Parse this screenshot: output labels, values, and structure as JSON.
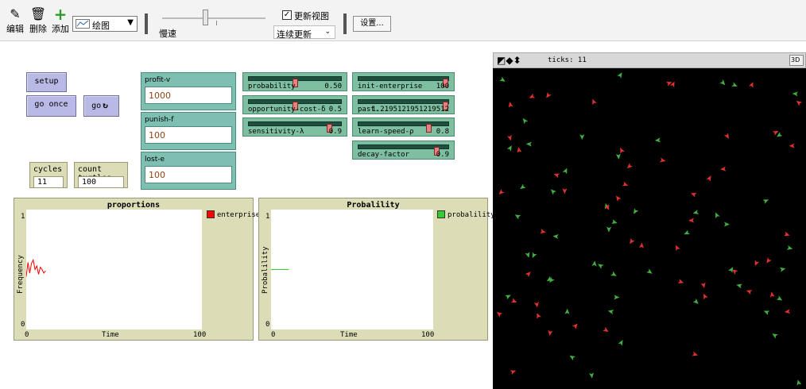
{
  "toolbar": {
    "edit_label": "编辑",
    "delete_label": "删除",
    "add_label": "添加",
    "shape_select_value": "绘图",
    "speed_label": "慢速",
    "speed_level": 0.45,
    "update_view_checked": true,
    "update_view_label": "更新视图",
    "update_mode_value": "连续更新",
    "settings_label": "设置..."
  },
  "buttons": {
    "setup": "setup",
    "go_once": "go once",
    "go": "go",
    "forever_icon": "forever-icon"
  },
  "monitors": {
    "cycles": {
      "label": "cycles",
      "value": "11"
    },
    "count_turtles": {
      "label": "count turtles",
      "value": "100"
    }
  },
  "inputs": {
    "profit_v": {
      "label": "profit-v",
      "value": "1000"
    },
    "punish_f": {
      "label": "punish-f",
      "value": "100"
    },
    "lost_e": {
      "label": "lost-e",
      "value": "100"
    }
  },
  "sliders": {
    "probability": {
      "label": "probability",
      "value": "0.50",
      "fraction": 0.5
    },
    "opportunity_cost": {
      "label": "opportunity-cost-δ",
      "value": "0.5",
      "fraction": 0.5
    },
    "sensitivity": {
      "label": "sensitivity-λ",
      "value": "0.9",
      "fraction": 0.9
    },
    "init_enterprise": {
      "label": "init-enterprise",
      "value": "100",
      "fraction": 1.0
    },
    "past": {
      "label": "past...",
      "value": "1.2195121951219512",
      "fraction": 1.0
    },
    "learn_speed": {
      "label": "learn-speed-ρ",
      "value": "0.8",
      "fraction": 0.8
    },
    "decay_factor": {
      "label": "decay-factor",
      "value": "0.9",
      "fraction": 0.9
    }
  },
  "plots": {
    "proportions": {
      "title": "proportions",
      "xlabel": "Time",
      "ylabel": "Frequency",
      "x_min": "0",
      "x_max": "100",
      "y_min": "0",
      "y_max": "1",
      "legend": "enterprise",
      "legend_color": "#ff0000"
    },
    "probability": {
      "title": "Probalility",
      "xlabel": "Time",
      "ylabel": "Probalility",
      "x_min": "0",
      "x_max": "100",
      "y_min": "0",
      "y_max": "1",
      "legend": "probalility",
      "legend_color": "#33cc33"
    }
  },
  "chart_data": [
    {
      "type": "line",
      "title": "proportions",
      "xlabel": "Time",
      "ylabel": "Frequency",
      "xlim": [
        0,
        100
      ],
      "ylim": [
        0,
        1
      ],
      "series": [
        {
          "name": "enterprise",
          "color": "#ff0000",
          "x": [
            0,
            1,
            2,
            3,
            4,
            5,
            6,
            7,
            8,
            9,
            10,
            11
          ],
          "y": [
            0.44,
            0.56,
            0.47,
            0.55,
            0.58,
            0.5,
            0.53,
            0.46,
            0.52,
            0.5,
            0.47,
            0.49
          ]
        }
      ]
    },
    {
      "type": "line",
      "title": "Probalility",
      "xlabel": "Time",
      "ylabel": "Probalility",
      "xlim": [
        0,
        100
      ],
      "ylim": [
        0,
        1
      ],
      "series": [
        {
          "name": "probalility",
          "color": "#33cc33",
          "x": [
            0,
            1,
            2,
            3,
            4,
            5,
            6,
            7,
            8,
            9,
            10,
            11
          ],
          "y": [
            0.5,
            0.5,
            0.5,
            0.5,
            0.5,
            0.5,
            0.5,
            0.5,
            0.5,
            0.5,
            0.5,
            0.5
          ]
        }
      ]
    }
  ],
  "view": {
    "ticks_label": "ticks: 11",
    "btn_3d_label": "3D",
    "turtle_colors": [
      "#e03030",
      "#40b040"
    ]
  }
}
